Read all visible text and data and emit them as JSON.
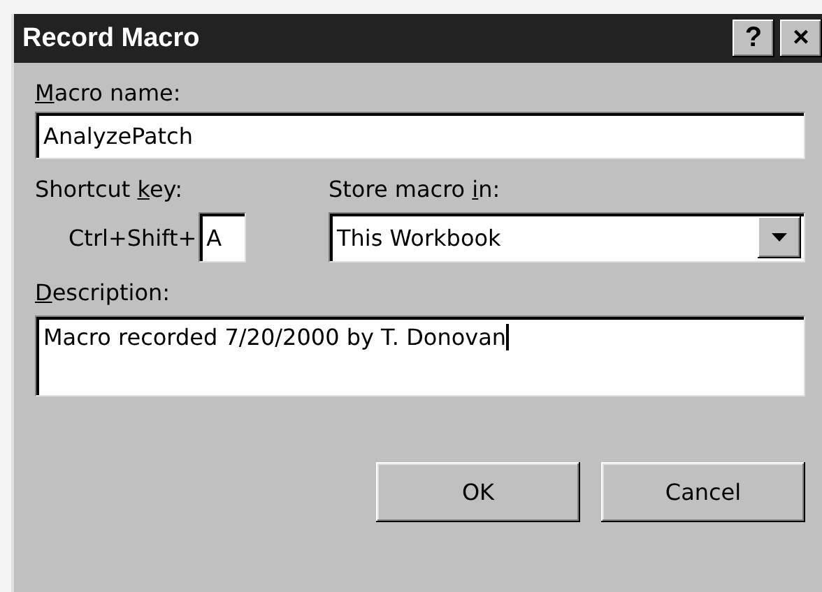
{
  "window": {
    "title": "Record Macro",
    "title_buttons": [
      "?",
      "×"
    ]
  },
  "macro_name": {
    "label": {
      "key": "M",
      "after": "acro name:"
    },
    "value": "AnalyzePatch"
  },
  "shortcut_key": {
    "label": {
      "before": "Shortcut ",
      "key": "k",
      "after": "ey:"
    },
    "prefix": "Ctrl+Shift+",
    "value": "A"
  },
  "store_macro_in": {
    "label": {
      "before": "Store macro ",
      "key": "i",
      "after": "n:"
    },
    "value": "This Workbook"
  },
  "description": {
    "label": {
      "key": "D",
      "after": "escription:"
    },
    "value": "Macro recorded 7/20/2000 by T. Donovan",
    "focused": true
  },
  "buttons": [
    "OK",
    "Cancel"
  ]
}
